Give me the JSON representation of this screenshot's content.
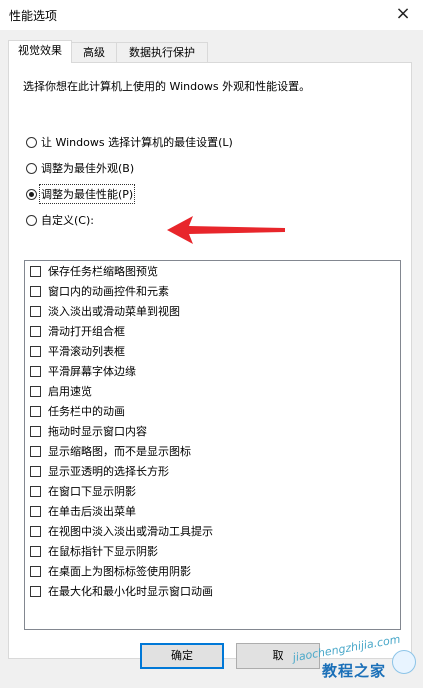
{
  "window": {
    "title": "性能选项",
    "close_symbol": "×"
  },
  "tabs": [
    {
      "label": "视觉效果"
    },
    {
      "label": "高级"
    },
    {
      "label": "数据执行保护"
    }
  ],
  "panel": {
    "description": "选择你想在此计算机上使用的 Windows 外观和性能设置。",
    "radios": [
      {
        "label": "让 Windows 选择计算机的最佳设置(L)",
        "checked": false
      },
      {
        "label": "调整为最佳外观(B)",
        "checked": false
      },
      {
        "label": "调整为最佳性能(P)",
        "checked": true
      },
      {
        "label": "自定义(C):",
        "checked": false
      }
    ],
    "options": [
      "保存任务栏缩略图预览",
      "窗口内的动画控件和元素",
      "淡入淡出或滑动菜单到视图",
      "滑动打开组合框",
      "平滑滚动列表框",
      "平滑屏幕字体边缘",
      "启用速览",
      "任务栏中的动画",
      "拖动时显示窗口内容",
      "显示缩略图，而不是显示图标",
      "显示亚透明的选择长方形",
      "在窗口下显示阴影",
      "在单击后淡出菜单",
      "在视图中淡入淡出或滑动工具提示",
      "在鼠标指针下显示阴影",
      "在桌面上为图标标签使用阴影",
      "在最大化和最小化时显示窗口动画"
    ]
  },
  "buttons": {
    "ok": "确定",
    "cancel": "取"
  },
  "annotation": {
    "arrow_color": "#e8262b"
  },
  "watermark": {
    "url": "jiaochengzhijia.com",
    "name": "教程之家"
  },
  "colors": {
    "accent": "#0078d7",
    "panel_bg": "#ffffff",
    "dialog_bg": "#f0f0f0"
  }
}
